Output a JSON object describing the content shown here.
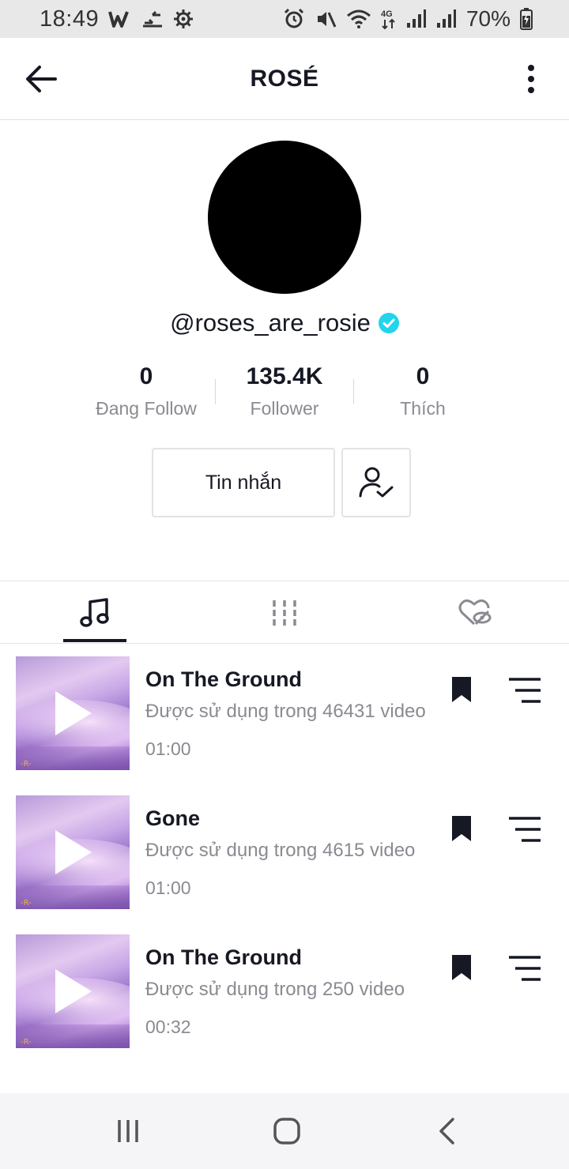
{
  "status_bar": {
    "time": "18:49",
    "battery": "70%",
    "network": "4G"
  },
  "header": {
    "title": "ROSÉ"
  },
  "profile": {
    "username": "@roses_are_rosie",
    "verified": true,
    "stats": [
      {
        "value": "0",
        "label": "Đang Follow"
      },
      {
        "value": "135.4K",
        "label": "Follower"
      },
      {
        "value": "0",
        "label": "Thích"
      }
    ],
    "message_button": "Tin nhắn"
  },
  "tabs": [
    {
      "icon": "music-note-icon",
      "active": true
    },
    {
      "icon": "grid-icon",
      "active": false
    },
    {
      "icon": "liked-hidden-icon",
      "active": false
    }
  ],
  "sounds": [
    {
      "title": "On The Ground",
      "subtitle": "Được sử dụng trong 46431 video",
      "duration": "01:00"
    },
    {
      "title": "Gone",
      "subtitle": "Được sử dụng trong 4615 video",
      "duration": "01:00"
    },
    {
      "title": "On The Ground",
      "subtitle": "Được sử dụng trong 250 video",
      "duration": "00:32"
    }
  ],
  "colors": {
    "accent_verified": "#20d5ec",
    "text_primary": "#161823",
    "text_secondary": "#8a8b91"
  }
}
